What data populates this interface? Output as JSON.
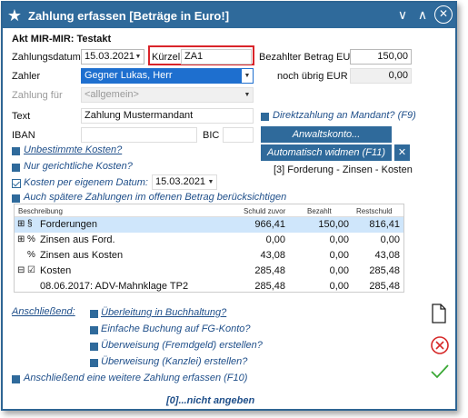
{
  "window": {
    "title": "Zahlung erfassen [Beträge in Euro!]"
  },
  "header": {
    "akt_label": "Akt MIR-MIR: Testakt"
  },
  "form": {
    "zahlungsdatum_label": "Zahlungsdatum",
    "zahlungsdatum_value": "15.03.2021",
    "kuerzel_label": "Kürzel",
    "kuerzel_value": "ZA1",
    "bezahlter_betrag_label": "Bezahlter Betrag EUR",
    "bezahlter_betrag_value": "150,00",
    "zahler_label": "Zahler",
    "zahler_value": "Gegner Lukas, Herr",
    "noch_uebrig_label": "noch übrig EUR",
    "noch_uebrig_value": "0,00",
    "zahlung_fuer_label": "Zahlung für",
    "zahlung_fuer_value": "<allgemein>",
    "text_label": "Text",
    "text_value": "Zahlung Mustermandant",
    "iban_label": "IBAN",
    "iban_value": "",
    "bic_label": "BIC",
    "bic_value": ""
  },
  "options": {
    "direktzahlung": "Direktzahlung an Mandant? (F9)",
    "anwaltskonto": "Anwaltskonto...",
    "automatisch_widmen": "Automatisch widmen (F11)",
    "widmung_info": "[3] Forderung - Zinsen - Kosten",
    "unbestimmte_kosten": "Unbestimmte Kosten?",
    "nur_gerichtliche": "Nur gerichtliche Kosten?",
    "kosten_eigenem_datum": "Kosten per eigenem Datum:",
    "kosten_datum_value": "15.03.2021",
    "auch_spaetere": "Auch spätere Zahlungen im offenen Betrag berücksichtigen"
  },
  "table": {
    "headers": [
      "Beschreibung",
      "Schuld zuvor",
      "Bezahlt",
      "Restschuld"
    ],
    "rows": [
      {
        "exp": "⊞",
        "icon": "§",
        "desc": "Forderungen",
        "schuld": "966,41",
        "bezahlt": "150,00",
        "rest": "816,41"
      },
      {
        "exp": "⊞",
        "icon": "%",
        "desc": "Zinsen aus Ford.",
        "schuld": "0,00",
        "bezahlt": "0,00",
        "rest": "0,00"
      },
      {
        "exp": "",
        "icon": "%",
        "desc": "Zinsen aus Kosten",
        "schuld": "43,08",
        "bezahlt": "0,00",
        "rest": "43,08"
      },
      {
        "exp": "⊟",
        "icon": "☑",
        "desc": "Kosten",
        "schuld": "285,48",
        "bezahlt": "0,00",
        "rest": "285,48"
      },
      {
        "exp": "",
        "icon": "",
        "desc": "08.06.2017: ADV-Mahnklage TP2",
        "schuld": "285,48",
        "bezahlt": "0,00",
        "rest": "285,48"
      }
    ]
  },
  "anschliessend": {
    "label": "Anschließend:",
    "items": [
      "Überleitung in Buchhaltung?",
      "Einfache Buchung auf FG-Konto?",
      "Überweisung (Fremdgeld) erstellen?",
      "Überweisung (Kanzlei) erstellen?"
    ],
    "weitere": "Anschließend eine weitere Zahlung erfassen (F10)"
  },
  "footer": {
    "nicht_angeben": "[0]...nicht angeben"
  },
  "colors": {
    "accent": "#2f6a9b",
    "selection": "#1e6fcf",
    "row_highlight": "#cfe6fb",
    "cancel": "#d62828",
    "ok": "#3aa835"
  }
}
